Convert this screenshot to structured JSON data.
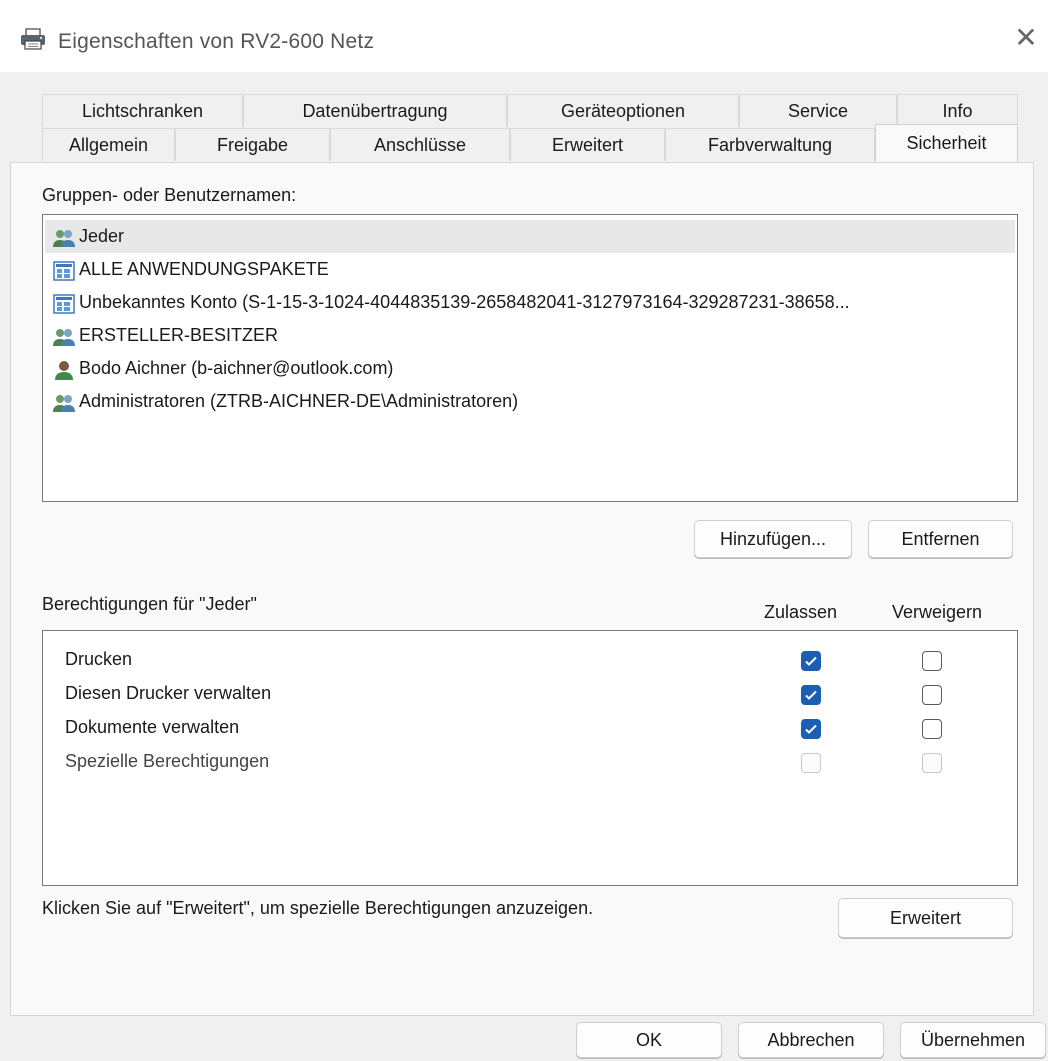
{
  "window": {
    "title": "Eigenschaften von RV2-600 Netz",
    "icon": "printer-icon",
    "close_glyph": "✕"
  },
  "tabs_row1": [
    {
      "label": "Lichtschranken"
    },
    {
      "label": "Datenübertragung"
    },
    {
      "label": "Geräteoptionen"
    },
    {
      "label": "Service"
    },
    {
      "label": "Info"
    }
  ],
  "tabs_row2": [
    {
      "label": "Allgemein"
    },
    {
      "label": "Freigabe"
    },
    {
      "label": "Anschlüsse"
    },
    {
      "label": "Erweitert"
    },
    {
      "label": "Farbverwaltung"
    },
    {
      "label": "Sicherheit",
      "active": true
    }
  ],
  "groups": {
    "heading": "Gruppen- oder Benutzernamen:",
    "items": [
      {
        "label": "Jeder",
        "icon": "group-icon",
        "selected": true
      },
      {
        "label": "ALLE ANWENDUNGSPAKETE",
        "icon": "app-package-icon"
      },
      {
        "label": "Unbekanntes Konto (S-1-15-3-1024-4044835139-2658482041-3127973164-329287231-38658...",
        "icon": "unknown-account-icon"
      },
      {
        "label": "ERSTELLER-BESITZER",
        "icon": "group-icon"
      },
      {
        "label": "Bodo Aichner (b-aichner@outlook.com)",
        "icon": "user-icon"
      },
      {
        "label": "Administratoren (ZTRB-AICHNER-DE\\Administratoren)",
        "icon": "group-icon"
      }
    ],
    "add_button": "Hinzufügen...",
    "remove_button": "Entfernen"
  },
  "permissions": {
    "heading": "Berechtigungen für \"Jeder\"",
    "col_allow": "Zulassen",
    "col_deny": "Verweigern",
    "rows": [
      {
        "label": "Drucken",
        "allow": true,
        "deny": false,
        "disabled": false
      },
      {
        "label": "Diesen Drucker verwalten",
        "allow": true,
        "deny": false,
        "disabled": false
      },
      {
        "label": "Dokumente verwalten",
        "allow": true,
        "deny": false,
        "disabled": false
      },
      {
        "label": "Spezielle Berechtigungen",
        "allow": false,
        "deny": false,
        "disabled": true
      }
    ],
    "hint": "Klicken Sie auf \"Erweitert\", um spezielle Berechtigungen anzuzeigen.",
    "advanced_button": "Erweitert"
  },
  "footer": {
    "ok": "OK",
    "cancel": "Abbrechen",
    "apply": "Übernehmen"
  },
  "colors": {
    "accent": "#1a5fb4",
    "selection": "#e8e8e8"
  }
}
